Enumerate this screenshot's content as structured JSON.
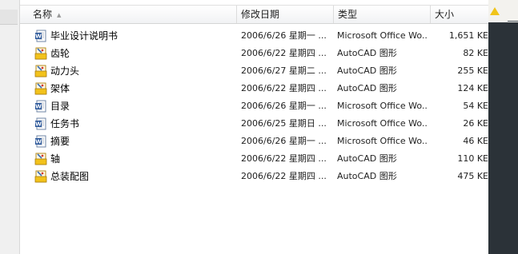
{
  "columns": {
    "name": "名称",
    "date": "修改日期",
    "type": "类型",
    "size": "大小"
  },
  "files": [
    {
      "name": "毕业设计说明书",
      "date": "2006/6/26 星期一 ...",
      "type": "Microsoft Office Wo...",
      "size": "1,651 KE",
      "icon": "word-doc-icon"
    },
    {
      "name": "齿轮",
      "date": "2006/6/22 星期四 ...",
      "type": "AutoCAD 图形",
      "size": "82 KE",
      "icon": "autocad-dwg-icon"
    },
    {
      "name": "动力头",
      "date": "2006/6/27 星期二 ...",
      "type": "AutoCAD 图形",
      "size": "255 KE",
      "icon": "autocad-dwg-icon"
    },
    {
      "name": "架体",
      "date": "2006/6/22 星期四 ...",
      "type": "AutoCAD 图形",
      "size": "124 KE",
      "icon": "autocad-dwg-icon"
    },
    {
      "name": "目录",
      "date": "2006/6/26 星期一 ...",
      "type": "Microsoft Office Wo...",
      "size": "54 KE",
      "icon": "word-doc-icon"
    },
    {
      "name": "任务书",
      "date": "2006/6/25 星期日 ...",
      "type": "Microsoft Office Wo...",
      "size": "26 KE",
      "icon": "word-doc-icon"
    },
    {
      "name": "摘要",
      "date": "2006/6/26 星期一 ...",
      "type": "Microsoft Office Wo...",
      "size": "46 KE",
      "icon": "word-doc-icon"
    },
    {
      "name": "轴",
      "date": "2006/6/22 星期四 ...",
      "type": "AutoCAD 图形",
      "size": "110 KE",
      "icon": "autocad-dwg-icon"
    },
    {
      "name": "总装配图",
      "date": "2006/6/22 星期四 ...",
      "type": "AutoCAD 图形",
      "size": "475 KE",
      "icon": "autocad-dwg-icon"
    }
  ]
}
